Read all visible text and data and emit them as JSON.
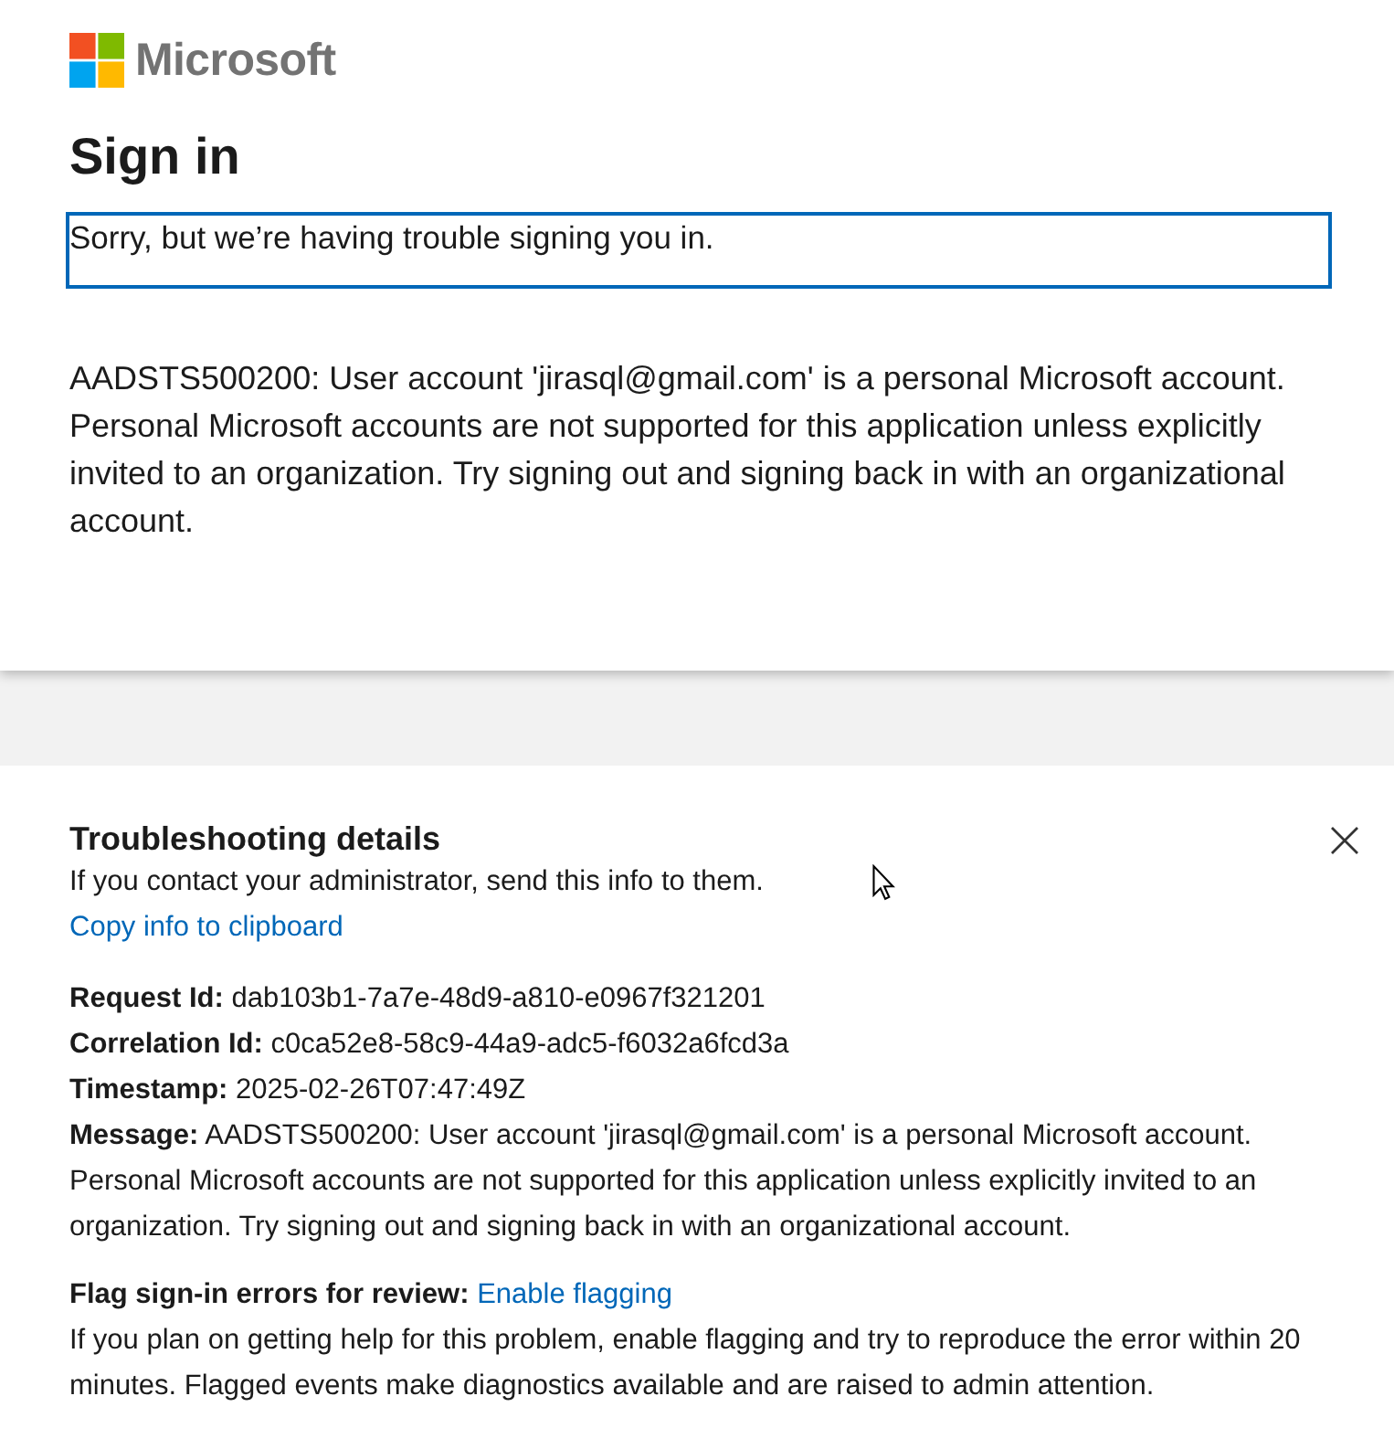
{
  "logo": {
    "text": "Microsoft"
  },
  "heading": "Sign in",
  "error_box": {
    "text": "Sorry, but we’re having trouble signing you in."
  },
  "error_message": "AADSTS500200: User account 'jirasql@gmail.com' is a personal Microsoft account. Personal Microsoft accounts are not supported for this application unless explicitly invited to an organization. Try signing out and signing back in with an organizational account.",
  "troubleshooting": {
    "title": "Troubleshooting details",
    "subtitle": "If you contact your administrator, send this info to them.",
    "copy_link": "Copy info to clipboard",
    "fields": [
      {
        "text": "**Request Id:** dab103b1-7a7e-48d9-a810-e0967f321201"
      },
      {
        "text": "**Correlation Id:** c0ca52e8-58c9-44a9-adc5-f6032a6fcd3a"
      },
      {
        "text": "**Timestamp:** 2025-02-26T07:47:49Z"
      },
      {
        "text": "**Message:** AADSTS500200: User account 'jirasql@gmail.com' is a personal Microsoft account. Personal Microsoft accounts are not supported for this application unless explicitly invited to an organization. Try signing out and signing back in with an organizational account."
      }
    ],
    "flag": {
      "label": "Flag sign-in errors for review:",
      "link": "Enable flagging"
    },
    "flag_note": "If you plan on getting help for this problem, enable flagging and try to reproduce the error within 20 minutes. Flagged events make diagnostics available and are raised to admin attention."
  }
}
